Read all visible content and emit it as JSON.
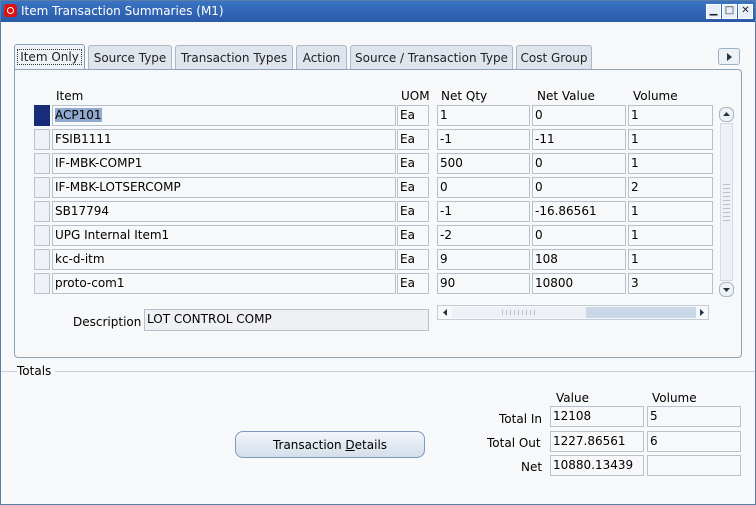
{
  "window": {
    "title": "Item Transaction Summaries (M1)"
  },
  "tabs": [
    "Item Only",
    "Source Type",
    "Transaction Types",
    "Action",
    "Source / Transaction Type",
    "Cost Group"
  ],
  "columns": {
    "item": "Item",
    "uom": "UOM",
    "net_qty": "Net Qty",
    "net_value": "Net Value",
    "volume": "Volume"
  },
  "rows": [
    {
      "item": "ACP101",
      "uom": "Ea",
      "net_qty": "1",
      "net_value": "0",
      "volume": "1"
    },
    {
      "item": "FSIB1111",
      "uom": "Ea",
      "net_qty": "-1",
      "net_value": "-11",
      "volume": "1"
    },
    {
      "item": "IF-MBK-COMP1",
      "uom": "Ea",
      "net_qty": "500",
      "net_value": "0",
      "volume": "1"
    },
    {
      "item": "IF-MBK-LOTSERCOMP",
      "uom": "Ea",
      "net_qty": "0",
      "net_value": "0",
      "volume": "2"
    },
    {
      "item": "SB17794",
      "uom": "Ea",
      "net_qty": "-1",
      "net_value": "-16.86561",
      "volume": "1"
    },
    {
      "item": "UPG Internal Item1",
      "uom": "Ea",
      "net_qty": "-2",
      "net_value": "0",
      "volume": "1"
    },
    {
      "item": "kc-d-itm",
      "uom": "Ea",
      "net_qty": "9",
      "net_value": "108",
      "volume": "1"
    },
    {
      "item": "proto-com1",
      "uom": "Ea",
      "net_qty": "90",
      "net_value": "10800",
      "volume": "3"
    }
  ],
  "description": {
    "label": "Description",
    "value": "LOT CONTROL COMP"
  },
  "totals": {
    "label": "Totals",
    "value_header": "Value",
    "volume_header": "Volume",
    "total_in_label": "Total In",
    "total_in_value": "12108",
    "total_in_volume": "5",
    "total_out_label": "Total Out",
    "total_out_value": "1227.86561",
    "total_out_volume": "6",
    "net_label": "Net",
    "net_value": "10880.13439",
    "net_volume": ""
  },
  "buttons": {
    "transaction_details_pre": "Transaction ",
    "transaction_details_mnemonic": "D",
    "transaction_details_post": "etails"
  }
}
